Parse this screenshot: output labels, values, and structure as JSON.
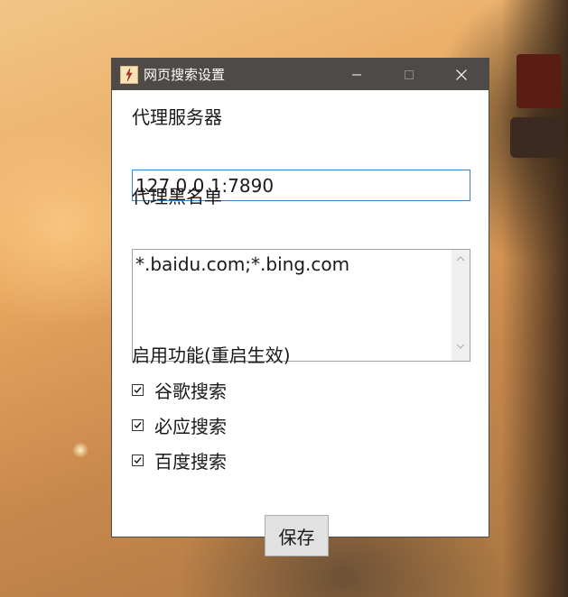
{
  "window": {
    "title": "网页搜索设置",
    "app_icon": "app-icon",
    "controls": [
      "minimize-icon",
      "maximize-icon",
      "close-icon"
    ]
  },
  "proxy": {
    "label": "代理服务器",
    "value": "127.0.0.1:7890"
  },
  "blacklist": {
    "label": "代理黑名单",
    "value": "*.baidu.com;*.bing.com"
  },
  "features": {
    "label": "启用功能(重启生效)",
    "items": [
      {
        "label": "谷歌搜索",
        "checked": true
      },
      {
        "label": "必应搜索",
        "checked": true
      },
      {
        "label": "百度搜索",
        "checked": true
      }
    ]
  },
  "actions": {
    "save_label": "保存"
  }
}
